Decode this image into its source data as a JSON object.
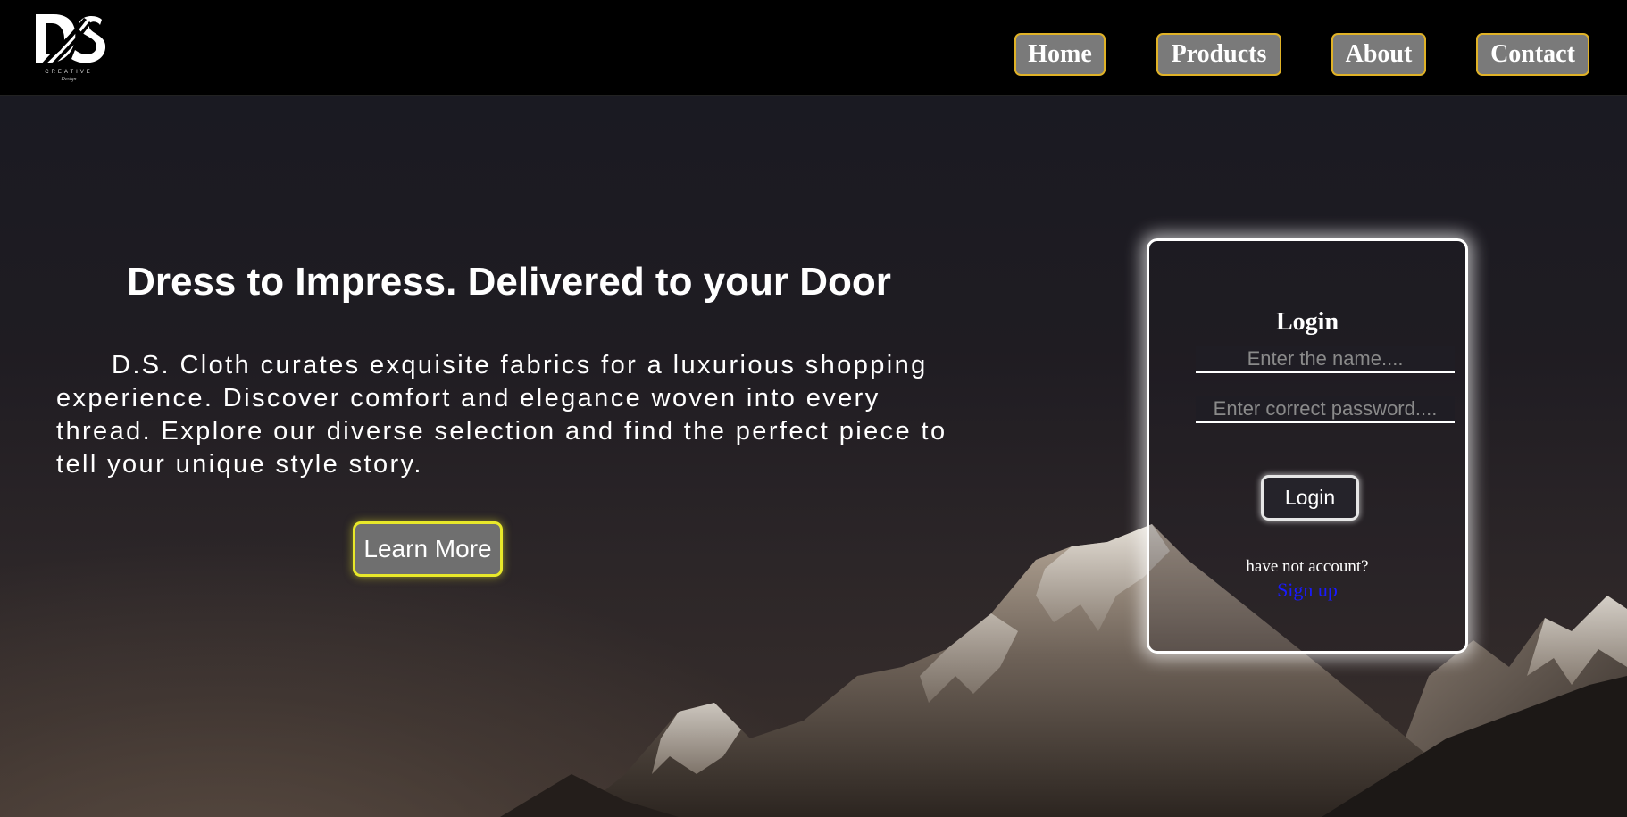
{
  "brand": {
    "logo_icon": "ds-logo-icon",
    "logo_text": "DS",
    "tagline": "CREATIVE",
    "tagline_script": "Design"
  },
  "nav": {
    "items": [
      {
        "label": "Home"
      },
      {
        "label": "Products"
      },
      {
        "label": "About"
      },
      {
        "label": "Contact"
      }
    ],
    "accent_border": "#e0b227",
    "button_bg": "#7a7a7a"
  },
  "hero": {
    "headline": "Dress to Impress. Delivered to your Door",
    "description": "D.S. Cloth curates exquisite fabrics for a luxurious shopping experience. Discover comfort and elegance woven into every thread. Explore our diverse selection and find the perfect piece to tell your unique style story.",
    "cta_label": "Learn More",
    "cta_border": "#e8e82a",
    "background_image": "mountain-landscape"
  },
  "login": {
    "title": "Login",
    "name_placeholder": "Enter the name....",
    "name_value": "",
    "password_placeholder": "Enter correct password....",
    "password_value": "",
    "button_label": "Login",
    "no_account_text": "have not account?",
    "signup_label": "Sign up",
    "signup_color": "#1a1aff"
  }
}
